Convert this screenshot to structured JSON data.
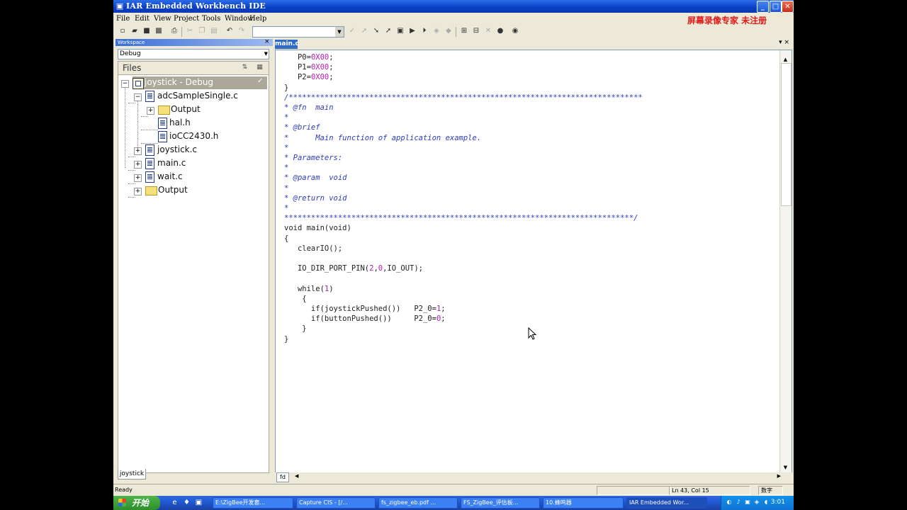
{
  "window": {
    "title": "IAR Embedded Workbench IDE",
    "controls": {
      "minimize": "_",
      "maximize": "□",
      "close": "✕"
    }
  },
  "menu": [
    "File",
    "Edit",
    "View",
    "Project",
    "Tools",
    "Window",
    "Help"
  ],
  "watermark": "屏幕录像专家 未注册",
  "toolbar": {
    "search_value": ""
  },
  "workspace": {
    "title": "Workspace",
    "configuration": "Debug",
    "files_header": "Files",
    "tree": [
      {
        "label": "joystick - Debug"
      },
      {
        "label": "adcSampleSingle.c"
      },
      {
        "label": "Output"
      },
      {
        "label": "hal.h"
      },
      {
        "label": "ioCC2430.h"
      },
      {
        "label": "joystick.c"
      },
      {
        "label": "main.c"
      },
      {
        "label": "wait.c"
      },
      {
        "label": "Output"
      }
    ],
    "tab": "joystick"
  },
  "editor": {
    "tab": "main.c",
    "bottom_tab": "fd",
    "code": [
      [
        {
          "t": "   P0="
        },
        {
          "t": "0X00",
          "c": "num"
        },
        {
          "t": ";"
        }
      ],
      [
        {
          "t": "   P1="
        },
        {
          "t": "0X00",
          "c": "num"
        },
        {
          "t": ";"
        }
      ],
      [
        {
          "t": "   P2="
        },
        {
          "t": "0X00",
          "c": "num"
        },
        {
          "t": ";"
        }
      ],
      [
        {
          "t": "}"
        }
      ],
      [
        {
          "t": "/*******************************************************************************",
          "c": "cm"
        }
      ],
      [
        {
          "t": "* @fn  main",
          "c": "cm"
        }
      ],
      [
        {
          "t": "*",
          "c": "cm"
        }
      ],
      [
        {
          "t": "* @brief",
          "c": "cm"
        }
      ],
      [
        {
          "t": "*      Main function of application example.",
          "c": "cm"
        }
      ],
      [
        {
          "t": "*",
          "c": "cm"
        }
      ],
      [
        {
          "t": "* Parameters:",
          "c": "cm"
        }
      ],
      [
        {
          "t": "*",
          "c": "cm"
        }
      ],
      [
        {
          "t": "* @param  void",
          "c": "cm"
        }
      ],
      [
        {
          "t": "*",
          "c": "cm"
        }
      ],
      [
        {
          "t": "* @return void",
          "c": "cm"
        }
      ],
      [
        {
          "t": "*",
          "c": "cm"
        }
      ],
      [
        {
          "t": "******************************************************************************/",
          "c": "cm"
        }
      ],
      [
        {
          "t": "void main(void)"
        }
      ],
      [
        {
          "t": "{"
        }
      ],
      [
        {
          "t": "   clearIO();"
        }
      ],
      [
        {
          "t": ""
        }
      ],
      [
        {
          "t": "   IO_DIR_PORT_PIN("
        },
        {
          "t": "2",
          "c": "num"
        },
        {
          "t": ","
        },
        {
          "t": "0",
          "c": "num"
        },
        {
          "t": ",IO_OUT);"
        }
      ],
      [
        {
          "t": ""
        }
      ],
      [
        {
          "t": "   while("
        },
        {
          "t": "1",
          "c": "num"
        },
        {
          "t": ")"
        }
      ],
      [
        {
          "t": "    {"
        }
      ],
      [
        {
          "t": "      if(joystickPushed())   P2_0="
        },
        {
          "t": "1",
          "c": "num"
        },
        {
          "t": ";"
        }
      ],
      [
        {
          "t": "      if(buttonPushed())     P2_0="
        },
        {
          "t": "0",
          "c": "num"
        },
        {
          "t": ";"
        }
      ],
      [
        {
          "t": "    }"
        }
      ],
      [
        {
          "t": "}"
        }
      ]
    ]
  },
  "status": {
    "ready": "Ready",
    "position": "Ln 43, Col 15",
    "mode": "数字"
  },
  "taskbar": {
    "start": "开始",
    "tasks": [
      "E:\\ZigBee开发套...",
      "Capture CIS - [/...",
      "fs_zigbee_eb.pdf ...",
      "FS_ZigBee_评估板...",
      "10.蜂鸣器",
      "IAR Embedded Wor..."
    ],
    "clock": "3:01"
  }
}
